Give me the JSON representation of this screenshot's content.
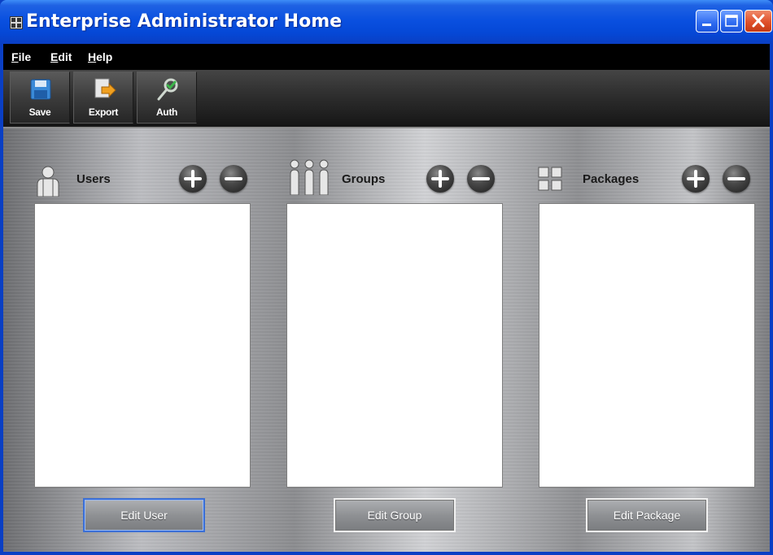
{
  "window": {
    "title": "Enterprise Administrator Home"
  },
  "menu": {
    "items": [
      {
        "label": "File",
        "accel": "F"
      },
      {
        "label": "Edit",
        "accel": "E"
      },
      {
        "label": "Help",
        "accel": "H"
      }
    ]
  },
  "toolbar": {
    "buttons": [
      {
        "label": "Save",
        "icon": "save-icon"
      },
      {
        "label": "Export",
        "icon": "export-icon"
      },
      {
        "label": "Auth",
        "icon": "auth-key-icon"
      }
    ]
  },
  "panels": {
    "users": {
      "title": "Users",
      "icon": "user-icon",
      "items": [],
      "action_label": "Edit User"
    },
    "groups": {
      "title": "Groups",
      "icon": "group-icon",
      "items": [],
      "action_label": "Edit Group"
    },
    "packages": {
      "title": "Packages",
      "icon": "package-icon",
      "items": [],
      "action_label": "Edit Package"
    }
  },
  "colors": {
    "titlebar_blue": "#0a50e0",
    "close_red": "#e0502a",
    "menubar": "#000000",
    "list_background": "#ffffff"
  }
}
